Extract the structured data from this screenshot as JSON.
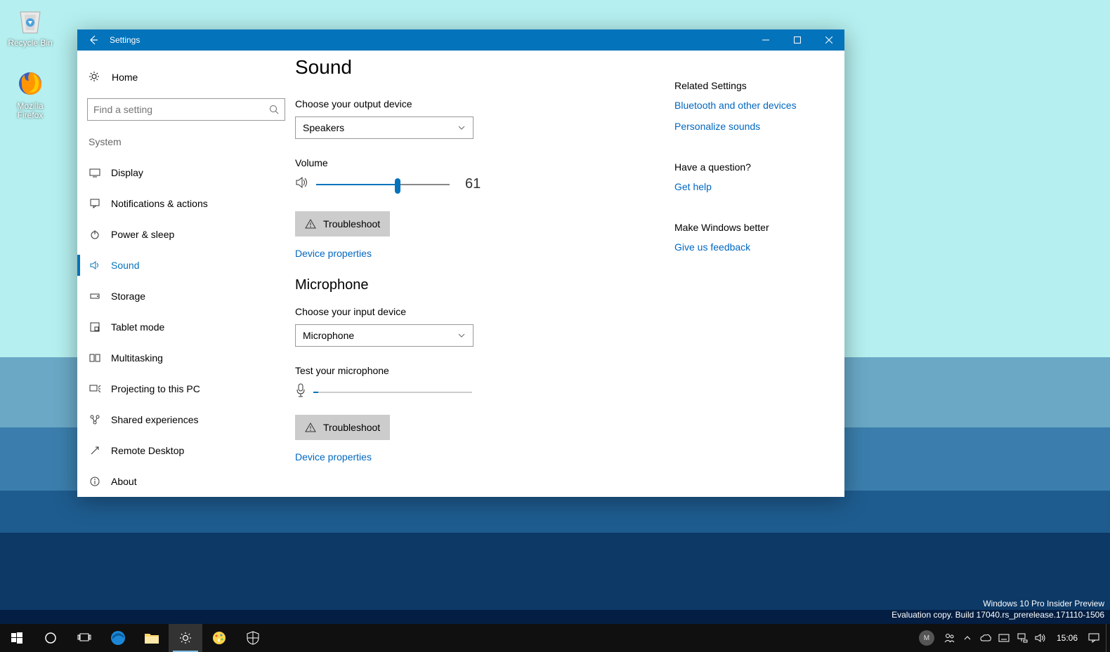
{
  "desktop": {
    "icons": [
      {
        "name": "recycle-bin",
        "label": "Recycle Bin"
      },
      {
        "name": "firefox",
        "label": "Mozilla Firefox"
      }
    ],
    "watermark_line1": "Windows 10 Pro Insider Preview",
    "watermark_line2": "Evaluation copy. Build 17040.rs_prerelease.171110-1506"
  },
  "window": {
    "title": "Settings",
    "home_label": "Home",
    "search_placeholder": "Find a setting",
    "section_label": "System",
    "nav": [
      {
        "key": "display",
        "label": "Display"
      },
      {
        "key": "notifications",
        "label": "Notifications & actions"
      },
      {
        "key": "power",
        "label": "Power & sleep"
      },
      {
        "key": "sound",
        "label": "Sound",
        "active": true
      },
      {
        "key": "storage",
        "label": "Storage"
      },
      {
        "key": "tablet",
        "label": "Tablet mode"
      },
      {
        "key": "multitasking",
        "label": "Multitasking"
      },
      {
        "key": "projecting",
        "label": "Projecting to this PC"
      },
      {
        "key": "shared",
        "label": "Shared experiences"
      },
      {
        "key": "remote",
        "label": "Remote Desktop"
      },
      {
        "key": "about",
        "label": "About"
      }
    ]
  },
  "main": {
    "page_title": "Sound",
    "output_label": "Choose your output device",
    "output_selected": "Speakers",
    "volume_label": "Volume",
    "volume_value": "61",
    "volume_percent": 61,
    "troubleshoot_label": "Troubleshoot",
    "device_props_label": "Device properties",
    "mic_header": "Microphone",
    "input_label": "Choose your input device",
    "input_selected": "Microphone",
    "mic_test_label": "Test your microphone",
    "mic_level_percent": 3
  },
  "right": {
    "related_title": "Related Settings",
    "related_links": [
      "Bluetooth and other devices",
      "Personalize sounds"
    ],
    "question_title": "Have a question?",
    "help_link": "Get help",
    "better_title": "Make Windows better",
    "feedback_link": "Give us feedback"
  },
  "taskbar": {
    "time": "15:06",
    "avatar_initial": "M"
  }
}
